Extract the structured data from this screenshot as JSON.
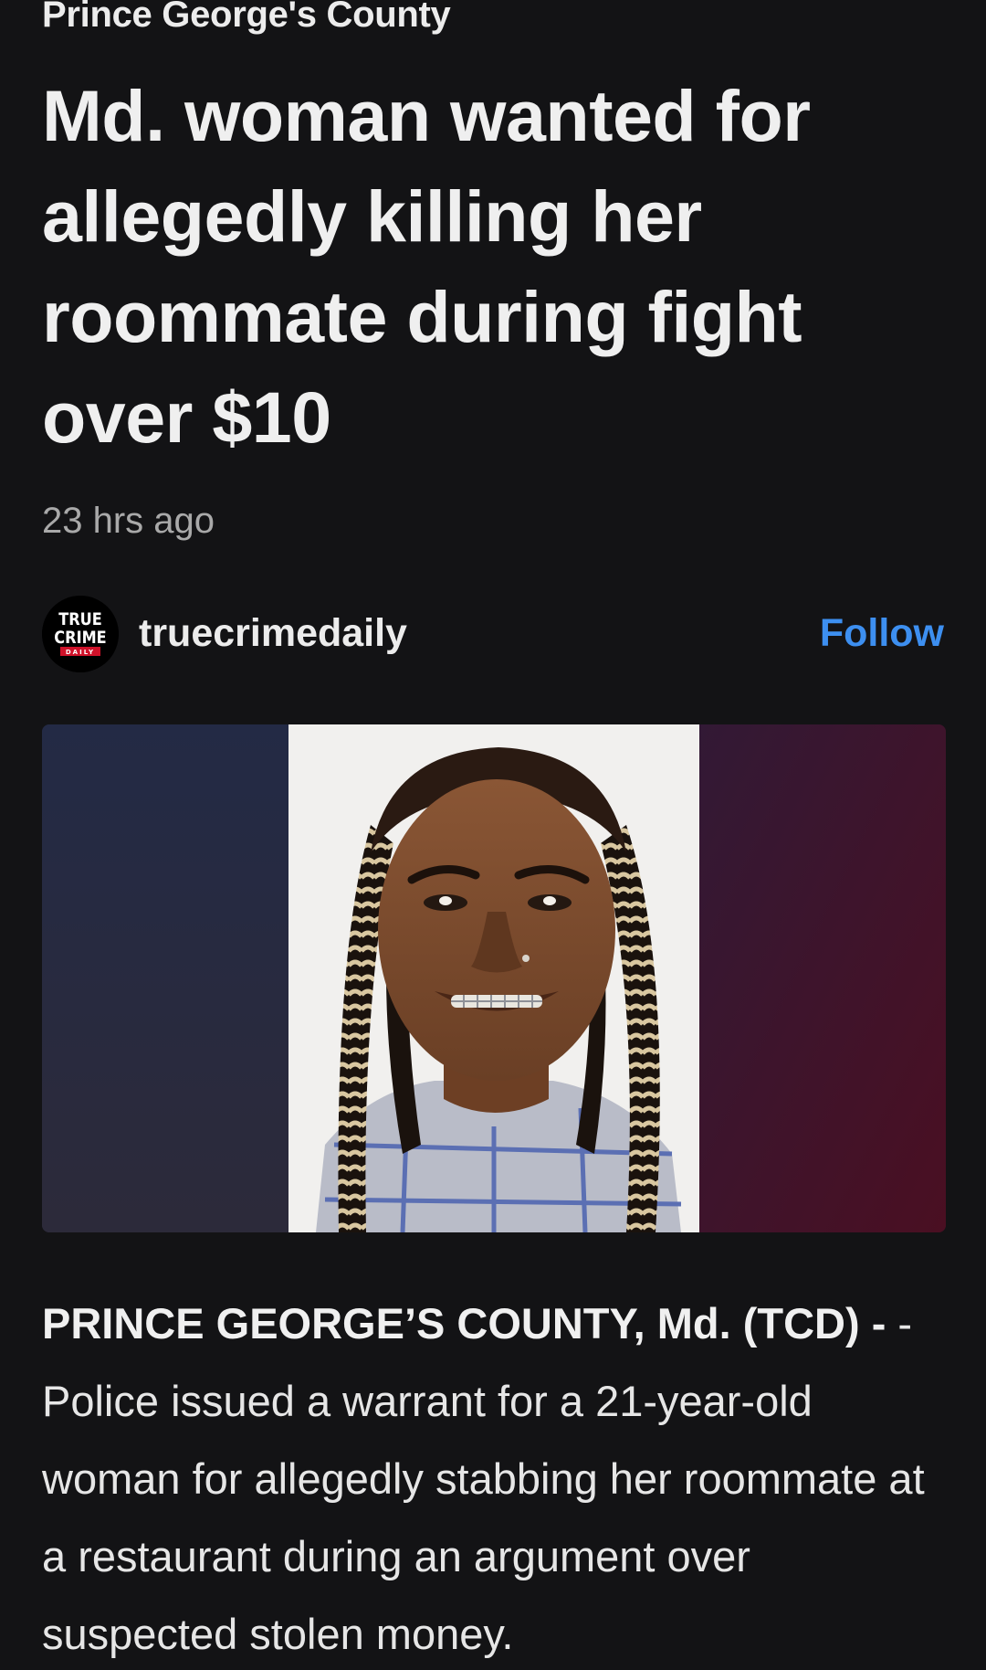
{
  "article": {
    "kicker": "Prince George's County",
    "headline": "Md. woman wanted for allegedly killing her roommate during fight over $10",
    "timestamp": "23 hrs ago",
    "source": {
      "name": "truecrimedaily",
      "logo_text": [
        "TRUE",
        "CRIME",
        "DAILY"
      ],
      "follow_label": "Follow"
    },
    "image": {
      "kind": "photo-icon"
    },
    "body": {
      "lead": "PRINCE GEORGE’S COUNTY, Md. (TCD) -",
      "text": " - Police issued a warrant for a 21-year-old woman for allegedly stabbing her roommate at a restaurant during an argument over suspected stolen money."
    }
  },
  "colors": {
    "background": "#131315",
    "follow_accent": "#3d8ff0",
    "logo_red": "#d0122a"
  }
}
